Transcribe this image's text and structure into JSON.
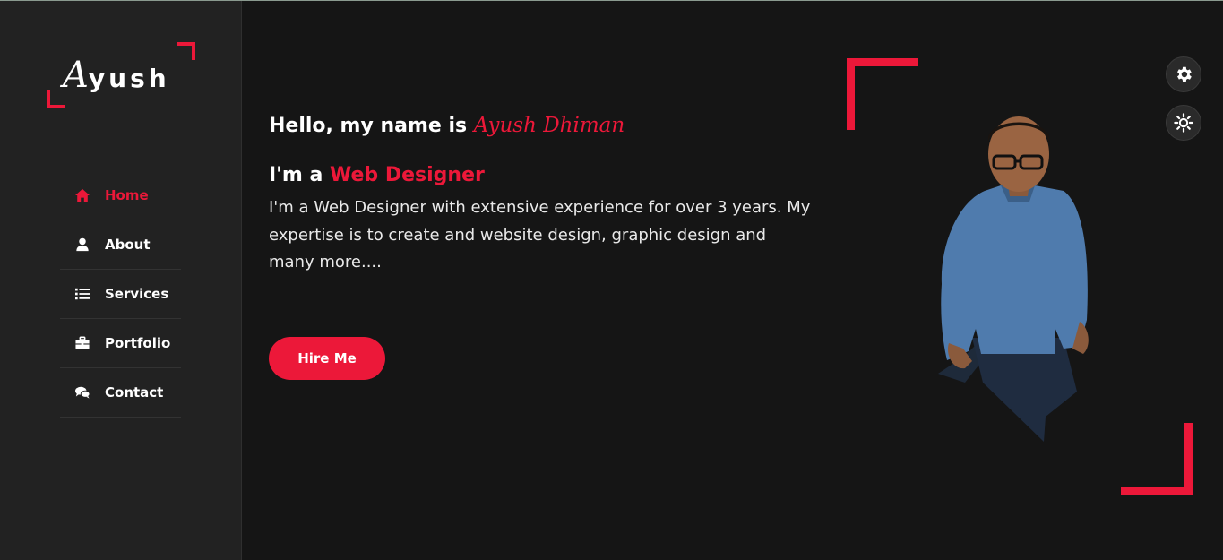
{
  "brand": {
    "logo_first": "A",
    "logo_rest": "yush",
    "accent_color": "#ec1839"
  },
  "sidebar": {
    "items": [
      {
        "label": "Home",
        "icon": "home-icon",
        "active": true
      },
      {
        "label": "About",
        "icon": "user-icon",
        "active": false
      },
      {
        "label": "Services",
        "icon": "list-icon",
        "active": false
      },
      {
        "label": "Portfolio",
        "icon": "briefcase-icon",
        "active": false
      },
      {
        "label": "Contact",
        "icon": "comments-icon",
        "active": false
      }
    ]
  },
  "hero": {
    "greeting": "Hello, my name is",
    "name": "Ayush Dhiman",
    "role_prefix": "I'm a",
    "role": "Web Designer",
    "description": "I'm a Web Designer with extensive experience for over 3 years. My expertise is to create and website design, graphic design and many more....",
    "cta_label": "Hire Me"
  },
  "controls": {
    "settings_icon": "gear-icon",
    "theme_icon": "sun-icon"
  }
}
